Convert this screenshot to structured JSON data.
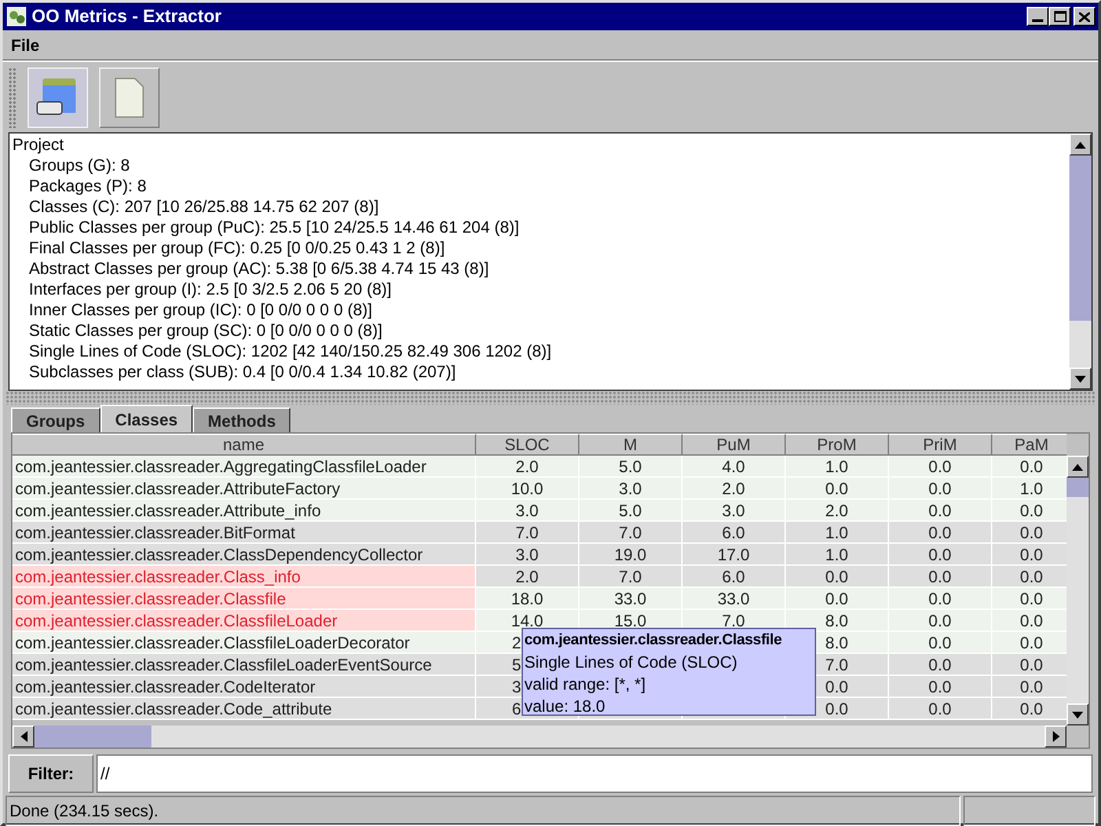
{
  "window": {
    "title": "OO Metrics - Extractor"
  },
  "menu": [
    "File"
  ],
  "project": {
    "title": "Project",
    "lines": [
      "Groups (G): 8",
      "Packages (P): 8",
      "Classes (C): 207 [10 26/25.88 14.75 62 207 (8)]",
      "Public Classes per group (PuC): 25.5 [10 24/25.5 14.46 61 204 (8)]",
      "Final Classes per group (FC): 0.25 [0 0/0.25 0.43 1 2 (8)]",
      "Abstract Classes per group (AC): 5.38 [0 6/5.38 4.74 15 43 (8)]",
      "Interfaces per group (I): 2.5 [0 3/2.5 2.06 5 20 (8)]",
      "Inner Classes per group (IC): 0 [0 0/0 0 0 0 (8)]",
      "Static Classes per group (SC): 0 [0 0/0 0 0 0 (8)]",
      "Single Lines of Code (SLOC): 1202 [42 140/150.25 82.49 306 1202 (8)]",
      "Subclasses per class (SUB): 0.4 [0 0/0.4 1.34 10.82 (207)]"
    ]
  },
  "tabs": [
    {
      "label": "Groups",
      "selected": false
    },
    {
      "label": "Classes",
      "selected": true
    },
    {
      "label": "Methods",
      "selected": false
    }
  ],
  "table": {
    "columns": [
      "name",
      "SLOC",
      "M",
      "PuM",
      "ProM",
      "PriM",
      "PaM"
    ],
    "rows": [
      {
        "flagged": false,
        "covered": false,
        "cells": [
          "com.jeantessier.classreader.AggregatingClassfileLoader",
          "2.0",
          "5.0",
          "4.0",
          "1.0",
          "0.0",
          "0.0"
        ]
      },
      {
        "flagged": false,
        "covered": false,
        "cells": [
          "com.jeantessier.classreader.AttributeFactory",
          "10.0",
          "3.0",
          "2.0",
          "0.0",
          "0.0",
          "1.0"
        ]
      },
      {
        "flagged": false,
        "covered": false,
        "cells": [
          "com.jeantessier.classreader.Attribute_info",
          "3.0",
          "5.0",
          "3.0",
          "2.0",
          "0.0",
          "0.0"
        ]
      },
      {
        "flagged": false,
        "covered": false,
        "cells": [
          "com.jeantessier.classreader.BitFormat",
          "7.0",
          "7.0",
          "6.0",
          "1.0",
          "0.0",
          "0.0"
        ]
      },
      {
        "flagged": false,
        "covered": false,
        "cells": [
          "com.jeantessier.classreader.ClassDependencyCollector",
          "3.0",
          "19.0",
          "17.0",
          "1.0",
          "0.0",
          "0.0"
        ]
      },
      {
        "flagged": true,
        "covered": false,
        "cells": [
          "com.jeantessier.classreader.Class_info",
          "2.0",
          "7.0",
          "6.0",
          "0.0",
          "0.0",
          "0.0"
        ]
      },
      {
        "flagged": true,
        "covered": false,
        "cells": [
          "com.jeantessier.classreader.Classfile",
          "18.0",
          "33.0",
          "33.0",
          "0.0",
          "0.0",
          "0.0"
        ]
      },
      {
        "flagged": true,
        "covered": false,
        "cells": [
          "com.jeantessier.classreader.ClassfileLoader",
          "14.0",
          "15.0",
          "7.0",
          "8.0",
          "0.0",
          "0.0"
        ]
      },
      {
        "flagged": false,
        "covered": true,
        "cells": [
          "com.jeantessier.classreader.ClassfileLoaderDecorator",
          "2",
          null,
          null,
          "8.0",
          "0.0",
          "0.0"
        ]
      },
      {
        "flagged": false,
        "covered": true,
        "cells": [
          "com.jeantessier.classreader.ClassfileLoaderEventSource",
          "5",
          null,
          null,
          "7.0",
          "0.0",
          "0.0"
        ]
      },
      {
        "flagged": false,
        "covered": true,
        "cells": [
          "com.jeantessier.classreader.CodeIterator",
          "3",
          null,
          null,
          "0.0",
          "0.0",
          "0.0"
        ]
      },
      {
        "flagged": false,
        "covered": true,
        "cells": [
          "com.jeantessier.classreader.Code_attribute",
          "6",
          null,
          null,
          "0.0",
          "0.0",
          "0.0"
        ]
      }
    ]
  },
  "tooltip": {
    "title": "com.jeantessier.classreader.Classfile",
    "lines": [
      "Single Lines of Code (SLOC)",
      "valid range: [*, *]",
      "value: 18.0"
    ]
  },
  "filter": {
    "label": "Filter:",
    "value": "//"
  },
  "status_bar": {
    "text": "Done (234.15 secs)."
  }
}
